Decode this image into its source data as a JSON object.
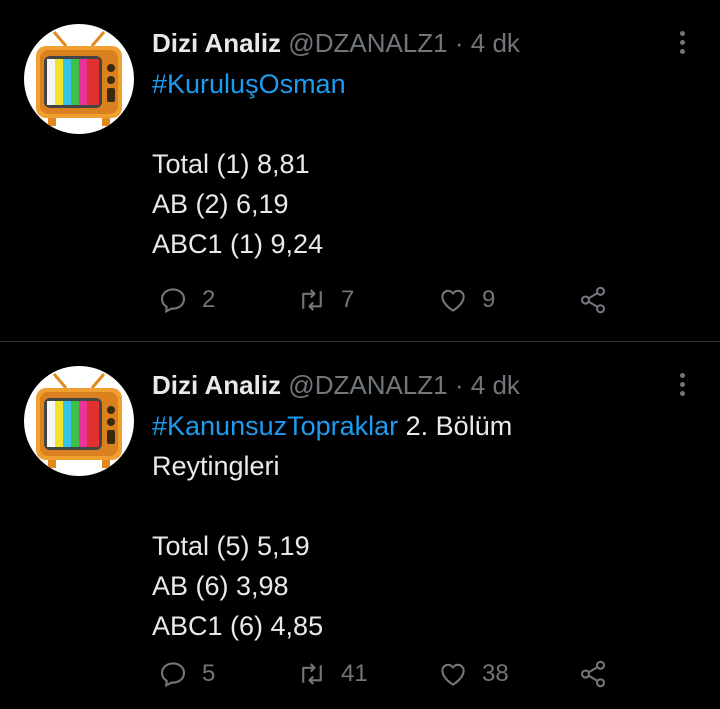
{
  "tweets": [
    {
      "author": "Dizi Analiz",
      "handle": "@DZANALZ1",
      "separator": "·",
      "time": "4 dk",
      "lines": [
        {
          "hashtag": "#KuruluşOsman",
          "text": ""
        },
        {
          "hashtag": "",
          "text": ""
        },
        {
          "hashtag": "",
          "text": "Total (1) 8,81"
        },
        {
          "hashtag": "",
          "text": "AB (2) 6,19"
        },
        {
          "hashtag": "",
          "text": "ABC1 (1) 9,24"
        }
      ],
      "replies": "2",
      "retweets": "7",
      "likes": "9"
    },
    {
      "author": "Dizi Analiz",
      "handle": "@DZANALZ1",
      "separator": "·",
      "time": "4 dk",
      "lines": [
        {
          "hashtag": "#KanunsuzTopraklar",
          "text": " 2. Bölüm"
        },
        {
          "hashtag": "",
          "text": "Reytingleri"
        },
        {
          "hashtag": "",
          "text": ""
        },
        {
          "hashtag": "",
          "text": "Total (5) 5,19"
        },
        {
          "hashtag": "",
          "text": "AB (6) 3,98"
        },
        {
          "hashtag": "",
          "text": "ABC1 (6) 4,85"
        }
      ],
      "replies": "5",
      "retweets": "41",
      "likes": "38"
    }
  ],
  "icons": {
    "reply": "reply-icon",
    "retweet": "retweet-icon",
    "like": "heart-icon",
    "share": "share-icon",
    "more": "more-options-icon",
    "avatar": "retro-tv-avatar"
  },
  "colors": {
    "background": "#000000",
    "text": "#e7e9ea",
    "muted": "#71767b",
    "link": "#1d9bf0",
    "divider": "#2f3336"
  }
}
